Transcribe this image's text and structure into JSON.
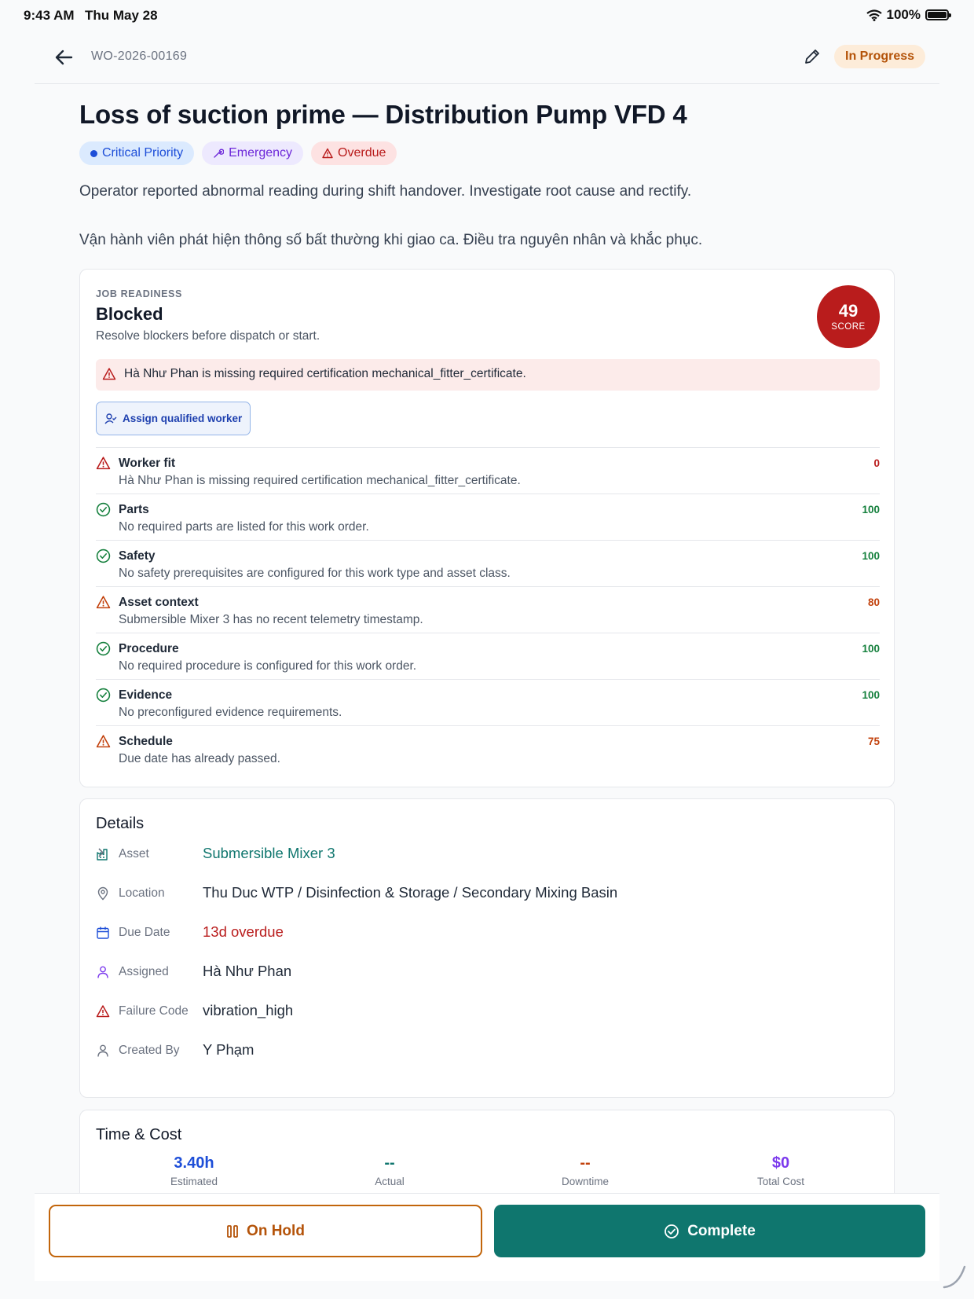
{
  "status_bar": {
    "time": "9:43 AM",
    "date": "Thu May 28",
    "battery": "100%"
  },
  "header": {
    "work_order_id": "WO-2026-00169",
    "status": "In Progress"
  },
  "title": "Loss of suction prime — Distribution Pump VFD 4",
  "chips": {
    "priority": "Critical Priority",
    "type": "Emergency",
    "overdue": "Overdue"
  },
  "description": "Operator reported abnormal reading during shift handover. Investigate root cause and rectify.\n\nVận hành viên phát hiện thông số bất thường khi giao ca. Điều tra nguyên nhân và khắc phục.",
  "readiness": {
    "kicker": "JOB READINESS",
    "status": "Blocked",
    "subtitle": "Resolve blockers before dispatch or start.",
    "score": "49",
    "score_label": "SCORE",
    "alert": "Hà Như Phan is missing required certification mechanical_fitter_certificate.",
    "action": "Assign qualified worker",
    "checks": [
      {
        "title": "Worker fit",
        "desc": "Hà Như Phan is missing required certification mechanical_fitter_certificate.",
        "score": "0",
        "state": "fail"
      },
      {
        "title": "Parts",
        "desc": "No required parts are listed for this work order.",
        "score": "100",
        "state": "pass"
      },
      {
        "title": "Safety",
        "desc": "No safety prerequisites are configured for this work type and asset class.",
        "score": "100",
        "state": "pass"
      },
      {
        "title": "Asset context",
        "desc": "Submersible Mixer 3 has no recent telemetry timestamp.",
        "score": "80",
        "state": "warn"
      },
      {
        "title": "Procedure",
        "desc": "No required procedure is configured for this work order.",
        "score": "100",
        "state": "pass"
      },
      {
        "title": "Evidence",
        "desc": "No preconfigured evidence requirements.",
        "score": "100",
        "state": "pass"
      },
      {
        "title": "Schedule",
        "desc": "Due date has already passed.",
        "score": "75",
        "state": "warn"
      }
    ]
  },
  "details": {
    "title": "Details",
    "asset_label": "Asset",
    "asset": "Submersible Mixer 3",
    "location_label": "Location",
    "location": "Thu Duc WTP / Disinfection & Storage / Secondary Mixing Basin",
    "due_label": "Due Date",
    "due": "13d overdue",
    "assigned_label": "Assigned",
    "assigned": "Hà Như Phan",
    "failure_label": "Failure Code",
    "failure": "vibration_high",
    "created_label": "Created By",
    "created": "Y Phạm"
  },
  "time_cost": {
    "title": "Time & Cost",
    "estimated": "3.40h",
    "estimated_label": "Estimated",
    "actual": "--",
    "actual_label": "Actual",
    "downtime": "--",
    "downtime_label": "Downtime",
    "total": "$0",
    "total_label": "Total Cost"
  },
  "actions": {
    "hold": "On Hold",
    "complete": "Complete"
  },
  "colors": {
    "accent": "#0f766e",
    "danger": "#b91c1c",
    "warning": "#c2410c",
    "success": "#15803d"
  }
}
